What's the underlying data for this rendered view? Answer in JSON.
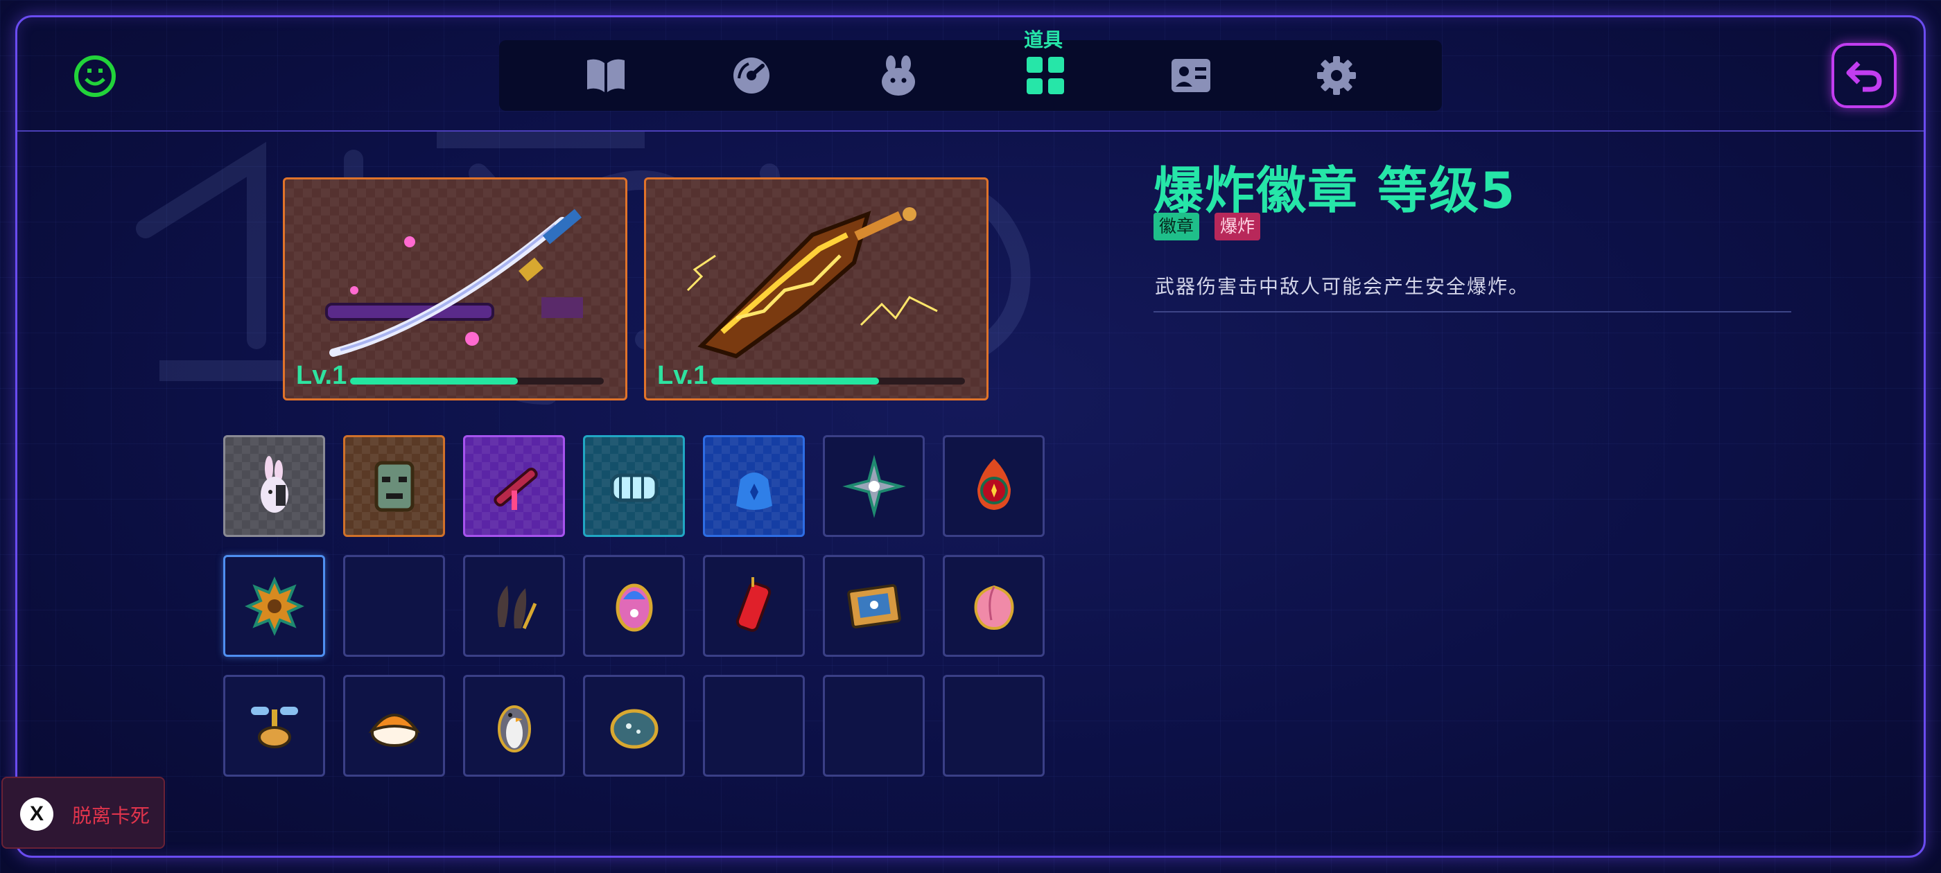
{
  "tabbar": {
    "tabs": [
      {
        "icon": "book-icon"
      },
      {
        "icon": "gauge-icon"
      },
      {
        "icon": "pet-paw-icon"
      },
      {
        "icon": "items-grid-icon",
        "label": "道具",
        "active": true
      },
      {
        "icon": "profile-card-icon"
      },
      {
        "icon": "gear-icon"
      }
    ],
    "active_color": "#26e6a8",
    "inactive_color": "#8a90b8"
  },
  "weapons": [
    {
      "name_icon": "katana-icon",
      "level": "Lv.1",
      "progress": 0.66
    },
    {
      "name_icon": "lightning-greatsword-icon",
      "level": "Lv.1",
      "progress": 0.66
    }
  ],
  "items": [
    [
      {
        "icon": "bunny-doll-icon",
        "rarity": "gray"
      },
      {
        "icon": "tribal-mask-icon",
        "rarity": "orange"
      },
      {
        "icon": "red-stick-icon",
        "rarity": "purple"
      },
      {
        "icon": "ice-fist-icon",
        "rarity": "teal"
      },
      {
        "icon": "coin-pouch-icon",
        "rarity": "blue"
      },
      {
        "icon": "shuriken-icon",
        "rarity": "none"
      },
      {
        "icon": "fire-orb-icon",
        "rarity": "none"
      }
    ],
    [
      {
        "icon": "explosion-badge-icon",
        "rarity": "none",
        "selected": true
      },
      {
        "icon": "",
        "rarity": "none"
      },
      {
        "icon": "claw-icon",
        "rarity": "none"
      },
      {
        "icon": "crystal-egg-icon",
        "rarity": "none"
      },
      {
        "icon": "firecracker-icon",
        "rarity": "none"
      },
      {
        "icon": "picture-frame-icon",
        "rarity": "none"
      },
      {
        "icon": "peach-icon",
        "rarity": "none"
      }
    ],
    [
      {
        "icon": "mini-drone-icon",
        "rarity": "none"
      },
      {
        "icon": "sushi-icon",
        "rarity": "none"
      },
      {
        "icon": "penguin-icon",
        "rarity": "none"
      },
      {
        "icon": "slime-stone-icon",
        "rarity": "none"
      },
      {
        "icon": "",
        "rarity": "none"
      },
      {
        "icon": "",
        "rarity": "none"
      },
      {
        "icon": "",
        "rarity": "none"
      }
    ]
  ],
  "detail": {
    "title": "爆炸徽章 等级5",
    "tags": [
      "徽章",
      "爆炸"
    ],
    "description": "武器伤害击中敌人可能会产生安全爆炸。"
  },
  "escape": {
    "key": "X",
    "label": "脱离卡死"
  },
  "colors": {
    "accent": "#26e6a8",
    "frame": "#6a4cf0",
    "back_button": "#c23df0",
    "danger": "#e0344c"
  }
}
